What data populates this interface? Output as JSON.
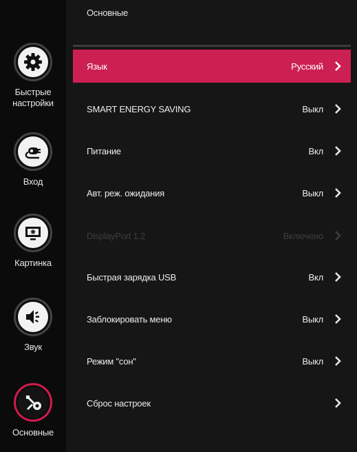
{
  "sidebar": {
    "items": [
      {
        "label": "Быстрые\nнастройки",
        "icon": "gear-icon",
        "active": false
      },
      {
        "label": "Вход",
        "icon": "input-icon",
        "active": false
      },
      {
        "label": "Картинка",
        "icon": "monitor-icon",
        "active": false
      },
      {
        "label": "Звук",
        "icon": "speaker-icon",
        "active": false
      },
      {
        "label": "Основные",
        "icon": "wrench-gear-icon",
        "active": true
      }
    ]
  },
  "main": {
    "title": "Основные",
    "rows": [
      {
        "label": "Язык",
        "value": "Русский",
        "state": "selected"
      },
      {
        "label": "SMART ENERGY SAVING",
        "value": "Выкл",
        "state": "normal"
      },
      {
        "label": "Питание",
        "value": "Вкл",
        "state": "normal"
      },
      {
        "label": "Авт. реж. ожидания",
        "value": "Выкл",
        "state": "normal"
      },
      {
        "label": "DisplayPort 1.2",
        "value": "Включено",
        "state": "disabled"
      },
      {
        "label": "Быстрая зарядка USB",
        "value": "Вкл",
        "state": "normal"
      },
      {
        "label": "Заблокировать меню",
        "value": "Выкл",
        "state": "normal"
      },
      {
        "label": "Режим \"сон\"",
        "value": "Выкл",
        "state": "normal"
      },
      {
        "label": "Сброс настроек",
        "value": "",
        "state": "normal"
      }
    ]
  },
  "colors": {
    "accent": "#cc1f52",
    "background": "#161616",
    "sidebar": "#0b0b0b"
  }
}
